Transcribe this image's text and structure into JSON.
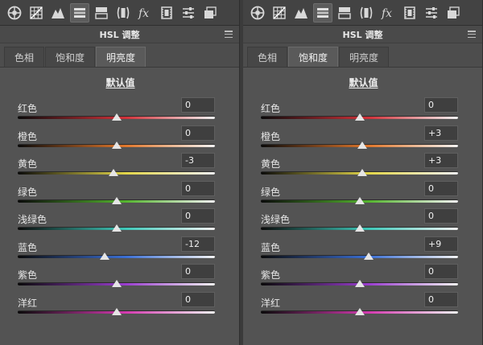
{
  "panels": [
    {
      "header_title": "HSL 调整",
      "tabs": [
        {
          "label": "色相",
          "active": false
        },
        {
          "label": "饱和度",
          "active": false
        },
        {
          "label": "明亮度",
          "active": true
        }
      ],
      "defaults_label": "默认值",
      "sliders": [
        {
          "label": "红色",
          "value": "0",
          "color": "#d2323a"
        },
        {
          "label": "橙色",
          "value": "0",
          "color": "#e0772c"
        },
        {
          "label": "黄色",
          "value": "-3",
          "color": "#e3d64a"
        },
        {
          "label": "绿色",
          "value": "0",
          "color": "#55b52f"
        },
        {
          "label": "浅绿色",
          "value": "0",
          "color": "#3fc8b9"
        },
        {
          "label": "蓝色",
          "value": "-12",
          "color": "#3b6fd4"
        },
        {
          "label": "紫色",
          "value": "0",
          "color": "#9b3ed0"
        },
        {
          "label": "洋红",
          "value": "0",
          "color": "#d43bb0"
        }
      ]
    },
    {
      "header_title": "HSL 调整",
      "tabs": [
        {
          "label": "色相",
          "active": false
        },
        {
          "label": "饱和度",
          "active": true
        },
        {
          "label": "明亮度",
          "active": false
        }
      ],
      "defaults_label": "默认值",
      "sliders": [
        {
          "label": "红色",
          "value": "0",
          "color": "#d2323a"
        },
        {
          "label": "橙色",
          "value": "+3",
          "color": "#e0772c"
        },
        {
          "label": "黄色",
          "value": "+3",
          "color": "#e3d64a"
        },
        {
          "label": "绿色",
          "value": "0",
          "color": "#55b52f"
        },
        {
          "label": "浅绿色",
          "value": "0",
          "color": "#3fc8b9"
        },
        {
          "label": "蓝色",
          "value": "+9",
          "color": "#3b6fd4"
        },
        {
          "label": "紫色",
          "value": "0",
          "color": "#9b3ed0"
        },
        {
          "label": "洋红",
          "value": "0",
          "color": "#d43bb0"
        }
      ]
    }
  ],
  "toolbar_icons": [
    "basic-aperture-icon",
    "tone-curve-grid-icon",
    "detail-mountain-icon",
    "hsl-icon",
    "split-toning-icon",
    "lens-corrections-icon",
    "fx-effects-icon",
    "camera-calibration-icon",
    "presets-sliders-icon",
    "snapshots-icon"
  ],
  "slider_range": [
    -100,
    100
  ]
}
